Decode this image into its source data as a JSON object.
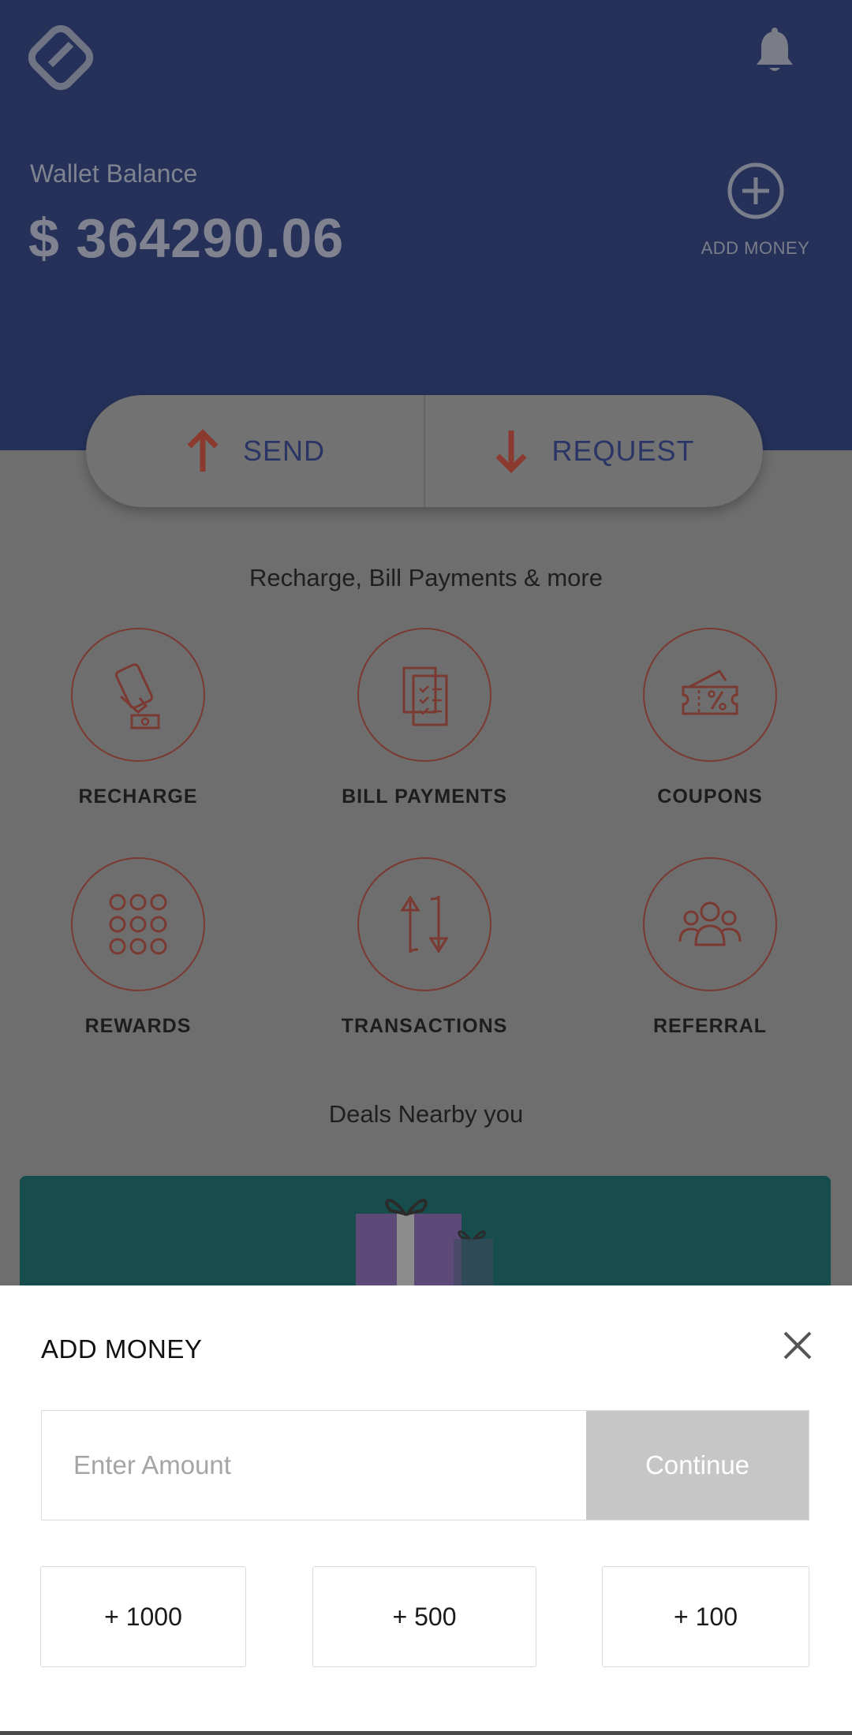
{
  "header": {
    "logo_icon": "app-logo-icon",
    "bell_icon": "bell-icon",
    "wallet_label": "Wallet Balance",
    "wallet_amount": "$ 364290.06",
    "add_money_label": "ADD MONEY"
  },
  "actions": {
    "send_label": "SEND",
    "request_label": "REQUEST"
  },
  "services": {
    "section_title": "Recharge, Bill Payments & more",
    "items": [
      {
        "label": "RECHARGE",
        "icon": "recharge-icon"
      },
      {
        "label": "BILL PAYMENTS",
        "icon": "bill-icon"
      },
      {
        "label": "COUPONS",
        "icon": "coupon-icon"
      },
      {
        "label": "REWARDS",
        "icon": "rewards-icon"
      },
      {
        "label": "TRANSACTIONS",
        "icon": "transactions-icon"
      },
      {
        "label": "REFERRAL",
        "icon": "referral-icon"
      }
    ]
  },
  "deals": {
    "section_title": "Deals Nearby you"
  },
  "sheet": {
    "title": "ADD MONEY",
    "amount_placeholder": "Enter Amount",
    "continue_label": "Continue",
    "quick_amounts": [
      "+ 1000",
      "+ 500",
      "+ 100"
    ]
  },
  "colors": {
    "header_bg": "#26315a",
    "accent": "#b5402f",
    "continue_disabled": "#c6c6c6"
  }
}
